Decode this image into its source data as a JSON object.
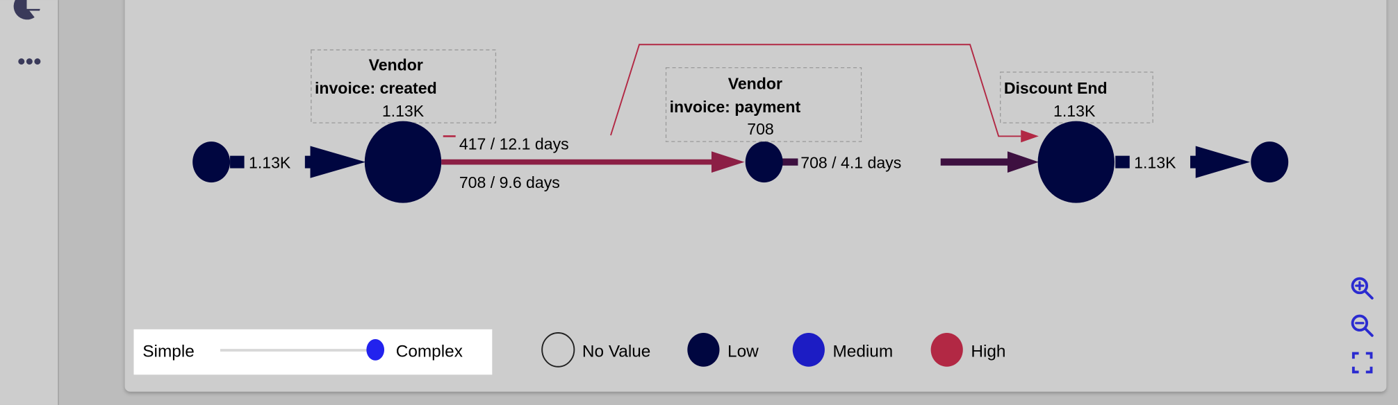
{
  "sidebar": {
    "icons": [
      "pie-chart-icon",
      "more-icon"
    ]
  },
  "graph": {
    "nodes": [
      {
        "title_line1": "Vendor",
        "title_line2": "invoice: created",
        "count": "1.13K"
      },
      {
        "title_line1": "Vendor",
        "title_line2": "invoice: payment",
        "count": "708"
      },
      {
        "title_line1": "Discount End",
        "count": "1.13K"
      }
    ],
    "edges": {
      "start_to_created": "1.13K",
      "created_to_discount": "417 / 12.1 days",
      "created_to_payment": "708 / 9.6 days",
      "payment_to_discount": "708 / 4.1 days",
      "discount_to_end": "1.13K"
    }
  },
  "complexity": {
    "min_label": "Simple",
    "max_label": "Complex",
    "value_percent": 100
  },
  "legend": [
    {
      "label": "No Value",
      "color": "none"
    },
    {
      "label": "Low",
      "color": "#000640"
    },
    {
      "label": "Medium",
      "color": "#1c1cc4"
    },
    {
      "label": "High",
      "color": "#b22844"
    }
  ],
  "colors": {
    "low": "#000640",
    "high_edge": "#8c1f45",
    "mid_edge": "#3d1040",
    "accent": "#2222ee",
    "controls": "#2a2ad0"
  },
  "controls": [
    "zoom-in-icon",
    "zoom-out-icon",
    "fit-screen-icon"
  ]
}
